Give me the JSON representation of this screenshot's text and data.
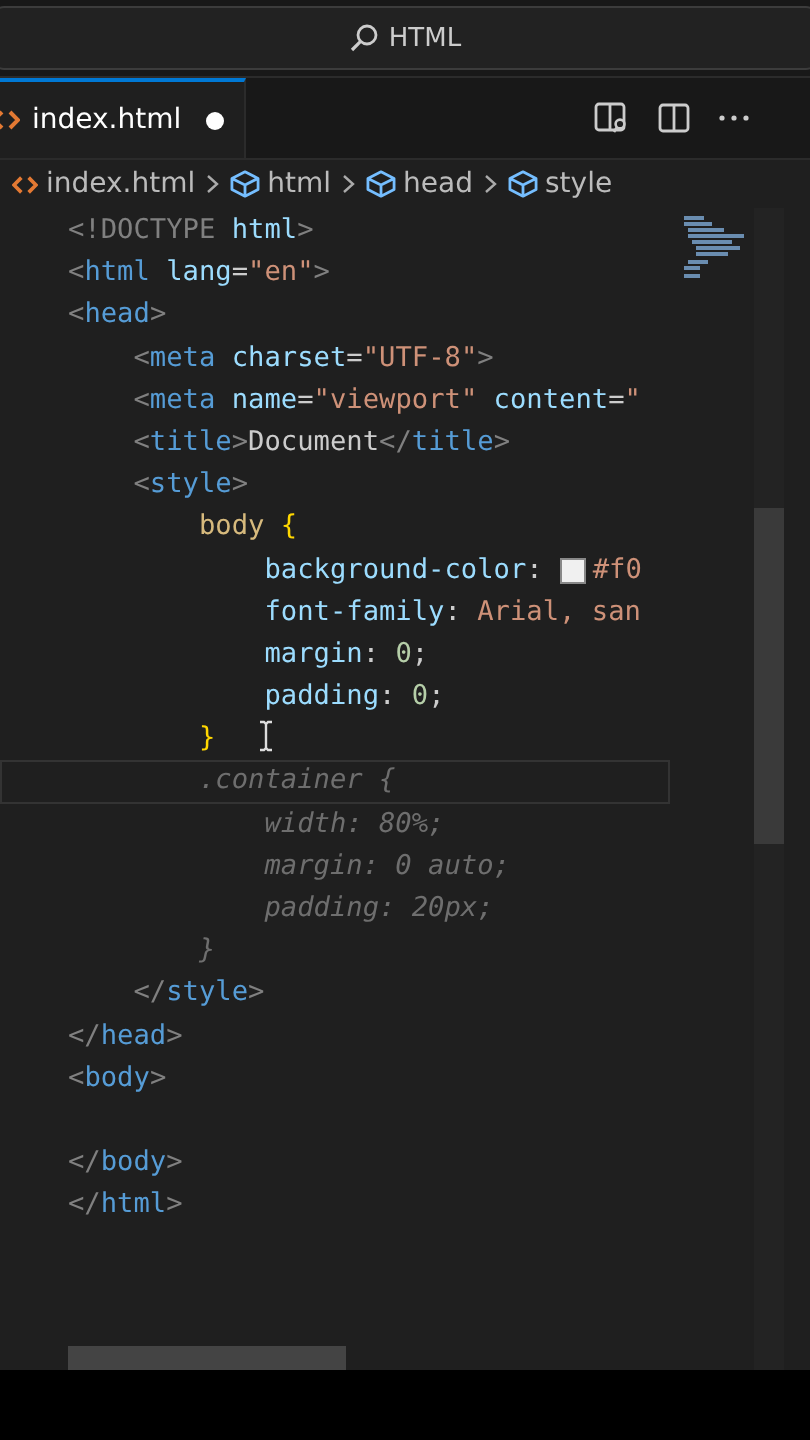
{
  "title_bar": {
    "search_label": "HTML"
  },
  "tabs": [
    {
      "label": "index.html",
      "selected": true,
      "modified": true
    }
  ],
  "breadcrumbs": [
    {
      "label": "index.html",
      "kind": "file"
    },
    {
      "label": "html",
      "kind": "element"
    },
    {
      "label": "head",
      "kind": "element"
    },
    {
      "label": "style",
      "kind": "element"
    }
  ],
  "editor": {
    "lines": [
      {
        "kind": "code",
        "current": false,
        "ghost": false,
        "tokens": [
          {
            "kind": "punct",
            "text": "<!DOCTYPE"
          },
          {
            "kind": "attr",
            "text": " html"
          },
          {
            "kind": "punct",
            "text": ">"
          }
        ]
      },
      {
        "kind": "code",
        "current": false,
        "ghost": false,
        "tokens": [
          {
            "kind": "punct",
            "text": "<"
          },
          {
            "kind": "tag",
            "text": "html"
          },
          {
            "kind": "attr",
            "text": " lang"
          },
          {
            "kind": "text",
            "text": "="
          },
          {
            "kind": "string",
            "text": "\"en\""
          },
          {
            "kind": "punct",
            "text": ">"
          }
        ]
      },
      {
        "kind": "code",
        "current": false,
        "ghost": false,
        "tokens": [
          {
            "kind": "punct",
            "text": "<"
          },
          {
            "kind": "tag",
            "text": "head"
          },
          {
            "kind": "punct",
            "text": ">"
          }
        ]
      },
      {
        "kind": "code",
        "current": false,
        "ghost": false,
        "tokens": [
          {
            "kind": "punct",
            "text": "    <"
          },
          {
            "kind": "tag",
            "text": "meta"
          },
          {
            "kind": "attr",
            "text": " charset"
          },
          {
            "kind": "text",
            "text": "="
          },
          {
            "kind": "string",
            "text": "\"UTF-8\""
          },
          {
            "kind": "punct",
            "text": ">"
          }
        ]
      },
      {
        "kind": "code",
        "current": false,
        "ghost": false,
        "tokens": [
          {
            "kind": "punct",
            "text": "    <"
          },
          {
            "kind": "tag",
            "text": "meta"
          },
          {
            "kind": "attr",
            "text": " name"
          },
          {
            "kind": "text",
            "text": "="
          },
          {
            "kind": "string",
            "text": "\"viewport\""
          },
          {
            "kind": "attr",
            "text": " content"
          },
          {
            "kind": "text",
            "text": "="
          },
          {
            "kind": "string",
            "text": "\""
          }
        ]
      },
      {
        "kind": "code",
        "current": false,
        "ghost": false,
        "tokens": [
          {
            "kind": "punct",
            "text": "    <"
          },
          {
            "kind": "tag",
            "text": "title"
          },
          {
            "kind": "punct",
            "text": ">"
          },
          {
            "kind": "text",
            "text": "Document"
          },
          {
            "kind": "punct",
            "text": "</"
          },
          {
            "kind": "tag",
            "text": "title"
          },
          {
            "kind": "punct",
            "text": ">"
          }
        ]
      },
      {
        "kind": "code",
        "current": false,
        "ghost": false,
        "tokens": [
          {
            "kind": "punct",
            "text": "    <"
          },
          {
            "kind": "tag",
            "text": "style"
          },
          {
            "kind": "punct",
            "text": ">"
          }
        ]
      },
      {
        "kind": "code",
        "current": false,
        "ghost": false,
        "tokens": [
          {
            "kind": "selector",
            "text": "        body"
          },
          {
            "kind": "brace",
            "text": " {"
          }
        ]
      },
      {
        "kind": "code",
        "current": false,
        "ghost": false,
        "tokens": [
          {
            "kind": "property",
            "text": "            background-color"
          },
          {
            "kind": "text",
            "text": ":"
          },
          {
            "kind": "swatch"
          },
          {
            "kind": "string",
            "text": "#f0"
          }
        ]
      },
      {
        "kind": "code",
        "current": false,
        "ghost": false,
        "tokens": [
          {
            "kind": "property",
            "text": "            font-family"
          },
          {
            "kind": "text",
            "text": ":"
          },
          {
            "kind": "string",
            "text": " Arial, san"
          }
        ]
      },
      {
        "kind": "code",
        "current": false,
        "ghost": false,
        "tokens": [
          {
            "kind": "property",
            "text": "            margin"
          },
          {
            "kind": "text",
            "text": ":"
          },
          {
            "kind": "number",
            "text": " 0"
          },
          {
            "kind": "text",
            "text": ";"
          }
        ]
      },
      {
        "kind": "code",
        "current": false,
        "ghost": false,
        "tokens": [
          {
            "kind": "property",
            "text": "            padding"
          },
          {
            "kind": "text",
            "text": ":"
          },
          {
            "kind": "number",
            "text": " 0"
          },
          {
            "kind": "text",
            "text": ";"
          }
        ]
      },
      {
        "kind": "code",
        "current": false,
        "ghost": false,
        "tokens": [
          {
            "kind": "brace",
            "text": "        }"
          }
        ]
      },
      {
        "kind": "code",
        "current": true,
        "ghost": true,
        "tokens": [
          {
            "kind": "text",
            "text": "        .container {"
          }
        ]
      },
      {
        "kind": "code",
        "current": false,
        "ghost": true,
        "tokens": [
          {
            "kind": "text",
            "text": "            width: 80%;"
          }
        ]
      },
      {
        "kind": "code",
        "current": false,
        "ghost": true,
        "tokens": [
          {
            "kind": "text",
            "text": "            margin: 0 auto;"
          }
        ]
      },
      {
        "kind": "code",
        "current": false,
        "ghost": true,
        "tokens": [
          {
            "kind": "text",
            "text": "            padding: 20px;"
          }
        ]
      },
      {
        "kind": "code",
        "current": false,
        "ghost": true,
        "tokens": [
          {
            "kind": "text",
            "text": "        }"
          }
        ]
      },
      {
        "kind": "code",
        "current": false,
        "ghost": false,
        "tokens": [
          {
            "kind": "punct",
            "text": "    </"
          },
          {
            "kind": "tag",
            "text": "style"
          },
          {
            "kind": "punct",
            "text": ">"
          }
        ]
      },
      {
        "kind": "code",
        "current": false,
        "ghost": false,
        "tokens": [
          {
            "kind": "punct",
            "text": "</"
          },
          {
            "kind": "tag",
            "text": "head"
          },
          {
            "kind": "punct",
            "text": ">"
          }
        ]
      },
      {
        "kind": "code",
        "current": false,
        "ghost": false,
        "tokens": [
          {
            "kind": "punct",
            "text": "<"
          },
          {
            "kind": "tag",
            "text": "body"
          },
          {
            "kind": "punct",
            "text": ">"
          }
        ]
      },
      {
        "kind": "blank"
      },
      {
        "kind": "code",
        "current": false,
        "ghost": false,
        "tokens": [
          {
            "kind": "punct",
            "text": "</"
          },
          {
            "kind": "tag",
            "text": "body"
          },
          {
            "kind": "punct",
            "text": ">"
          }
        ]
      },
      {
        "kind": "code",
        "current": false,
        "ghost": false,
        "tokens": [
          {
            "kind": "punct",
            "text": "</"
          },
          {
            "kind": "tag",
            "text": "html"
          },
          {
            "kind": "punct",
            "text": ">"
          }
        ]
      }
    ]
  }
}
